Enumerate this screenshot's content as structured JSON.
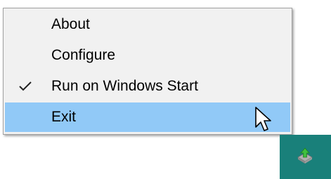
{
  "menu": {
    "items": [
      {
        "label": "About",
        "checked": false,
        "highlighted": false
      },
      {
        "label": "Configure",
        "checked": false,
        "highlighted": false
      },
      {
        "label": "Run on Windows Start",
        "checked": true,
        "highlighted": false
      },
      {
        "label": "Exit",
        "checked": false,
        "highlighted": true
      }
    ]
  },
  "tray": {
    "icon": "upload-arrow-icon",
    "background_color": "#19807a"
  },
  "colors": {
    "menu_background": "#f1f1f1",
    "highlight": "#91c9f7"
  }
}
